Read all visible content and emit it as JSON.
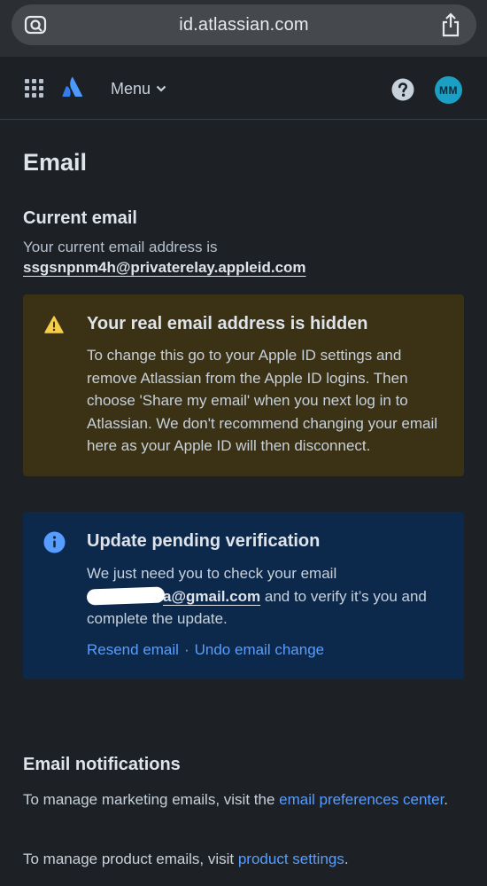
{
  "browser": {
    "url": "id.atlassian.com"
  },
  "header": {
    "menu_label": "Menu",
    "avatar_initials": "MM"
  },
  "page": {
    "title": "Email"
  },
  "current_email": {
    "heading": "Current email",
    "description": "Your current email address is",
    "value": "ssgsnpnm4h@privaterelay.appleid.com"
  },
  "warning": {
    "title": "Your real email address is hidden",
    "body": "To change this go to your Apple ID settings and remove Atlassian from the Apple ID logins. Then choose 'Share my email' when you next log in to Atlassian. We don't recommend changing your email here as your Apple ID will then disconnect."
  },
  "pending": {
    "title": "Update pending verification",
    "body_prefix": "We just need you to check your email",
    "email_visible": "a@gmail.com",
    "body_suffix": "and to verify it’s you and complete the update.",
    "resend_label": "Resend email",
    "separator": "·",
    "undo_label": "Undo email change"
  },
  "notifications": {
    "heading": "Email notifications",
    "marketing_prefix": "To manage marketing emails, visit the",
    "marketing_link": "email preferences center",
    "marketing_suffix": ".",
    "product_prefix": "To manage product emails, visit",
    "product_link": "product settings",
    "product_suffix": "."
  },
  "colors": {
    "background": "#1d2125",
    "warning_bg": "#3b3115",
    "info_bg": "#0c294c",
    "link": "#579dff",
    "avatar": "#1d9fc4"
  }
}
